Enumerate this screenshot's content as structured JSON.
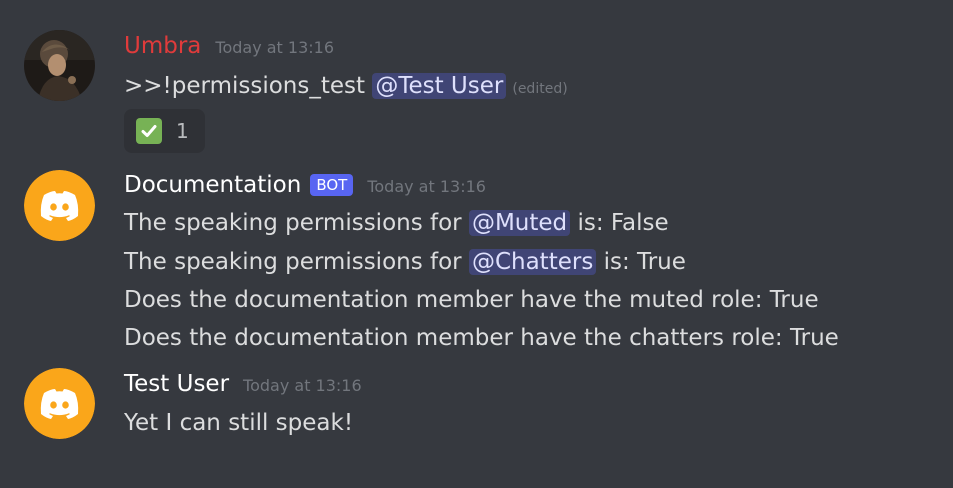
{
  "messages": [
    {
      "username": "Umbra",
      "timestamp": "Today at 13:16",
      "text_prefix": ">>!permissions_test ",
      "mention": "@Test User",
      "edited": "(edited)",
      "reaction": {
        "emoji": "white-check-mark-icon",
        "count": "1"
      }
    },
    {
      "username": "Documentation",
      "bot_tag": "BOT",
      "timestamp": "Today at 13:16",
      "lines": [
        {
          "prefix": "The speaking permissions for ",
          "mention": "@Muted",
          "suffix": " is: False"
        },
        {
          "prefix": "The speaking permissions for ",
          "mention": "@Chatters",
          "suffix": " is: True"
        },
        {
          "text": "Does the documentation member have the muted role: True"
        },
        {
          "text": "Does the documentation member have the chatters role: True"
        }
      ]
    },
    {
      "username": "Test User",
      "timestamp": "Today at 13:16",
      "text": "Yet I can still speak!"
    }
  ],
  "colors": {
    "background": "#36393f",
    "umbra_name": "#e03b3b",
    "mention_text": "#dee0fc",
    "bot_tag": "#5865f2",
    "discord_avatar": "#faa61a",
    "check": "#77b255"
  }
}
